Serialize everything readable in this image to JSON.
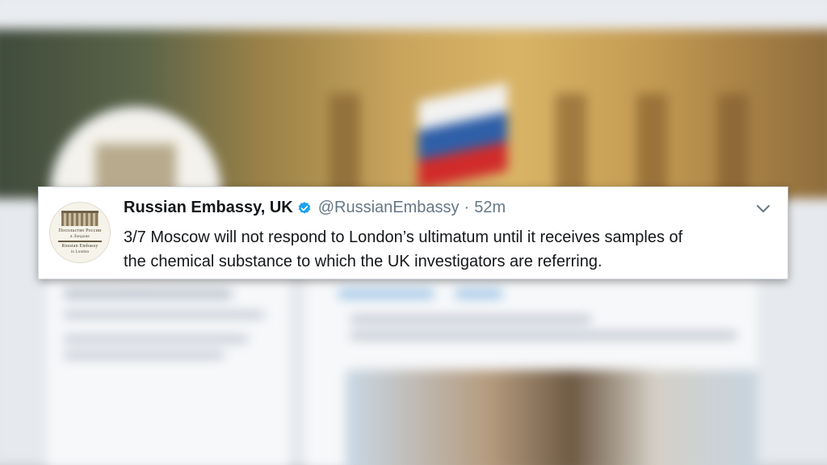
{
  "tweet": {
    "display_name": "Russian Embassy, UK",
    "handle": "@RussianEmbassy",
    "separator": "·",
    "time": "52m",
    "text_line1": "3/7 Moscow will not respond to London’s ultimatum until it receives samples of",
    "text_line2": "the chemical substance to which the UK investigators are referring.",
    "avatar": {
      "line1": "Посольство России",
      "line2": "в Лондоне",
      "line3": "Russian Embassy",
      "line4": "in London"
    }
  },
  "icons": {
    "verified": "verified-badge-icon",
    "menu": "chevron-down-icon"
  },
  "colors": {
    "verified_blue": "#1da1f2",
    "secondary_text": "#657786",
    "primary_text": "#14171a",
    "flag_white": "#f2f2f2",
    "flag_blue": "#2f5fa8",
    "flag_red": "#d12b2b"
  }
}
